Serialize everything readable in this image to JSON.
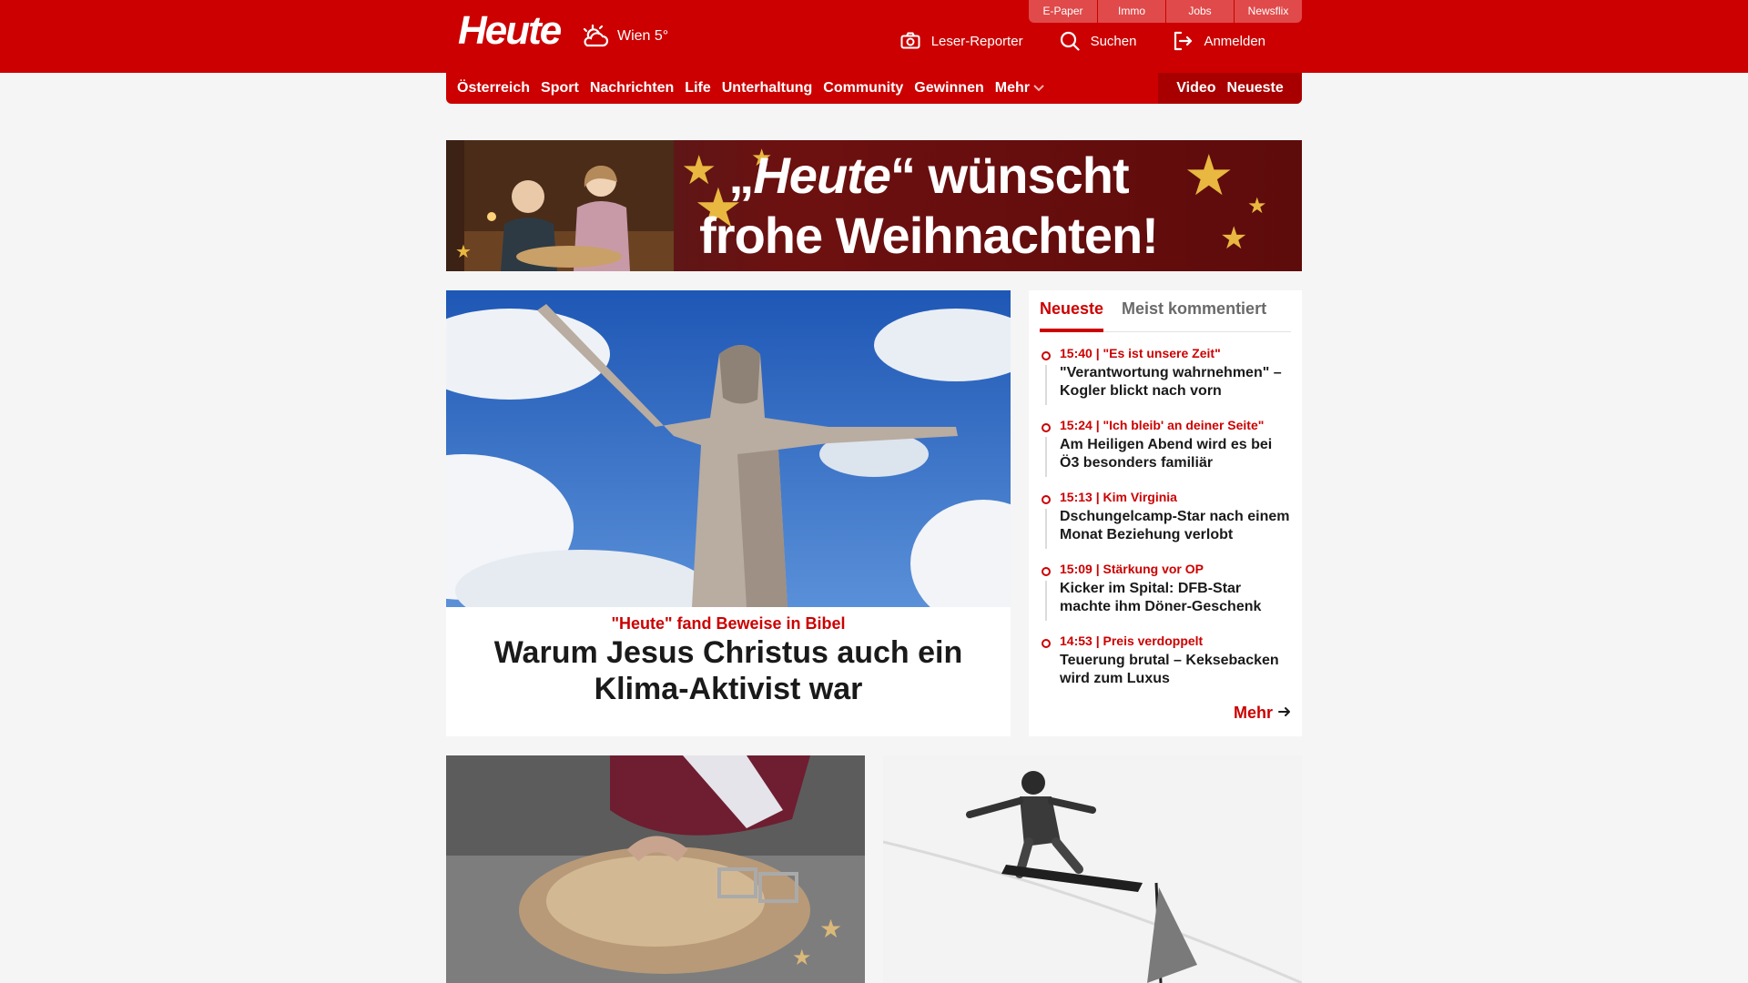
{
  "header": {
    "logo": "Heute",
    "weather": "Wien 5°",
    "top_links": [
      "E-Paper",
      "Immo",
      "Jobs",
      "Newsflix"
    ],
    "actions": [
      {
        "label": "Leser-Reporter",
        "icon": "camera-icon"
      },
      {
        "label": "Suchen",
        "icon": "search-icon"
      },
      {
        "label": "Anmelden",
        "icon": "login-icon"
      }
    ]
  },
  "nav": {
    "items": [
      "Österreich",
      "Sport",
      "Nachrichten",
      "Life",
      "Unterhaltung",
      "Community",
      "Gewinnen"
    ],
    "more": "Mehr",
    "right": [
      "Video",
      "Neueste"
    ]
  },
  "banner": {
    "quote_open": "„",
    "brand": "Heute",
    "quote_close": "“",
    "line1_rest": " wünscht",
    "line2": "frohe Weihnachten!"
  },
  "lead": {
    "kicker": "\"Heute\" fand Beweise in Bibel",
    "title": "Warum Jesus Christus auch ein Klima-Aktivist war"
  },
  "sidebar": {
    "tabs": [
      "Neueste",
      "Meist kommentiert"
    ],
    "items": [
      {
        "meta": "15:40 | \"Es ist unsere Zeit\"",
        "headline": "\"Verantwortung wahrnehmen\" – Kogler blickt nach vorn"
      },
      {
        "meta": "15:24 | \"Ich bleib' an deiner Seite\"",
        "headline": "Am Heiligen Abend wird es bei Ö3 besonders familiär"
      },
      {
        "meta": "15:13 | Kim Virginia",
        "headline": "Dschungelcamp-Star nach einem Monat Beziehung verlobt"
      },
      {
        "meta": "15:09 | Stärkung vor OP",
        "headline": "Kicker im Spital: DFB-Star machte ihm Döner-Geschenk"
      },
      {
        "meta": "14:53 | Preis verdoppelt",
        "headline": "Teuerung brutal – Keksebacken wird zum Luxus"
      }
    ],
    "more": "Mehr"
  },
  "colors": {
    "brand_red": "#cc0000",
    "dark_red": "#a80000",
    "background": "#f5f5f5"
  }
}
